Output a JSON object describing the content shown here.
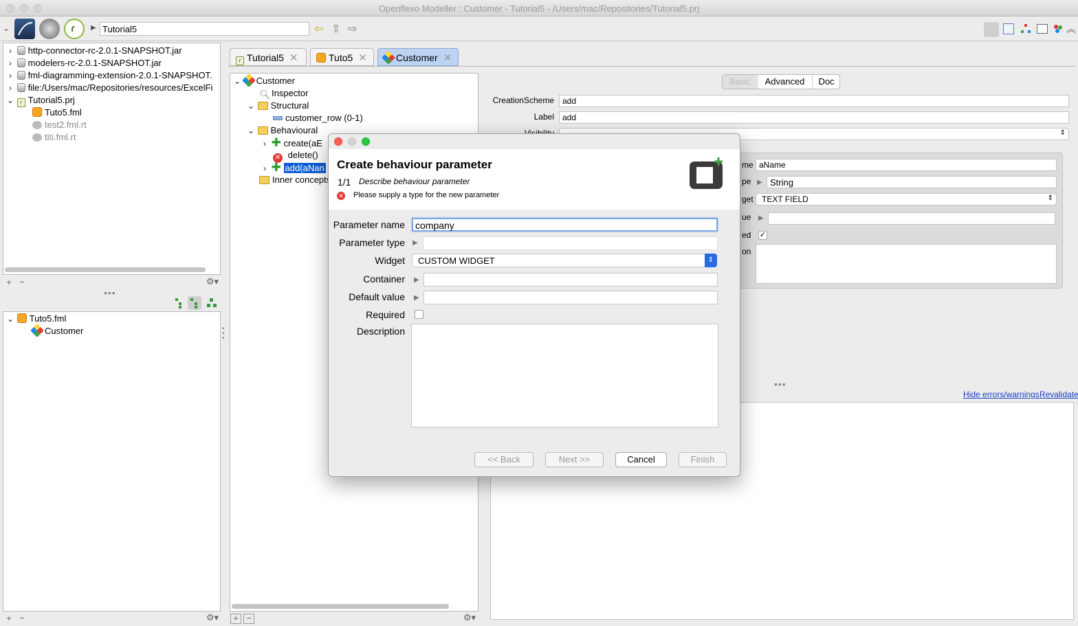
{
  "window": {
    "title": "Openflexo Modeller : Customer - Tutorial5 - /Users/mac/Repositories/Tutorial5.prj"
  },
  "toolbar": {
    "breadcrumb": "Tutorial5"
  },
  "resources": {
    "items": [
      {
        "label": "http-connector-rc-2.0.1-SNAPSHOT.jar"
      },
      {
        "label": "modelers-rc-2.0.1-SNAPSHOT.jar"
      },
      {
        "label": "fml-diagramming-extension-2.0.1-SNAPSHOT."
      },
      {
        "label": "file:/Users/mac/Repositories/resources/ExcelFi"
      },
      {
        "label": "Tutorial5.prj"
      },
      {
        "label": "Tuto5.fml"
      },
      {
        "label": "test2.fml.rt"
      },
      {
        "label": "titi.fml.rt"
      }
    ]
  },
  "outline": {
    "items": [
      {
        "label": "Tuto5.fml"
      },
      {
        "label": "Customer"
      }
    ]
  },
  "tabs": [
    {
      "label": "Tutorial5"
    },
    {
      "label": "Tuto5"
    },
    {
      "label": "Customer"
    }
  ],
  "concept_tree": {
    "items": [
      {
        "label": "Customer"
      },
      {
        "label": "Inspector"
      },
      {
        "label": "Structural"
      },
      {
        "label": "customer_row (0-1)"
      },
      {
        "label": "Behavioural"
      },
      {
        "label": "create(aE"
      },
      {
        "label": "delete()"
      },
      {
        "label": "add(aNan"
      },
      {
        "label": "Inner concepts"
      }
    ]
  },
  "inspector": {
    "tabs": {
      "basic": "Basic",
      "advanced": "Advanced",
      "doc": "Doc"
    },
    "creation_scheme_label": "CreationScheme",
    "creation_scheme_value": "add",
    "label_label": "Label",
    "label_value": "add",
    "visibility_label": "Visibility",
    "param_name_suffix": "me",
    "param_name_value": "aName",
    "param_type_suffix": "pe",
    "param_type_value": "String",
    "widget_suffix": "get",
    "widget_value": "TEXT FIELD",
    "default_suffix": "ue",
    "required_suffix": "ed",
    "required_check": "✓",
    "description_suffix": "on",
    "hide_link": "Hide errors/warnings",
    "revalidate_link": "Revalidate"
  },
  "dialog": {
    "title": "Create behaviour parameter",
    "step": "1/1",
    "step_desc": "Describe behaviour parameter",
    "error": "Please supply a type for the new parameter",
    "param_name_label": "Parameter name",
    "param_name_value": "company",
    "param_type_label": "Parameter type",
    "param_type_value": "",
    "widget_label": "Widget",
    "widget_value": "CUSTOM WIDGET",
    "container_label": "Container",
    "container_value": "",
    "default_label": "Default value",
    "default_value": "",
    "required_label": "Required",
    "description_label": "Description",
    "description_value": "",
    "buttons": {
      "back": "<< Back",
      "next": "Next >>",
      "cancel": "Cancel",
      "finish": "Finish"
    }
  },
  "colors": {
    "accent": "#2a6ae0",
    "selection": "#0e5fd8",
    "tab_active": "#bcd3f2",
    "error": "#e53935"
  }
}
